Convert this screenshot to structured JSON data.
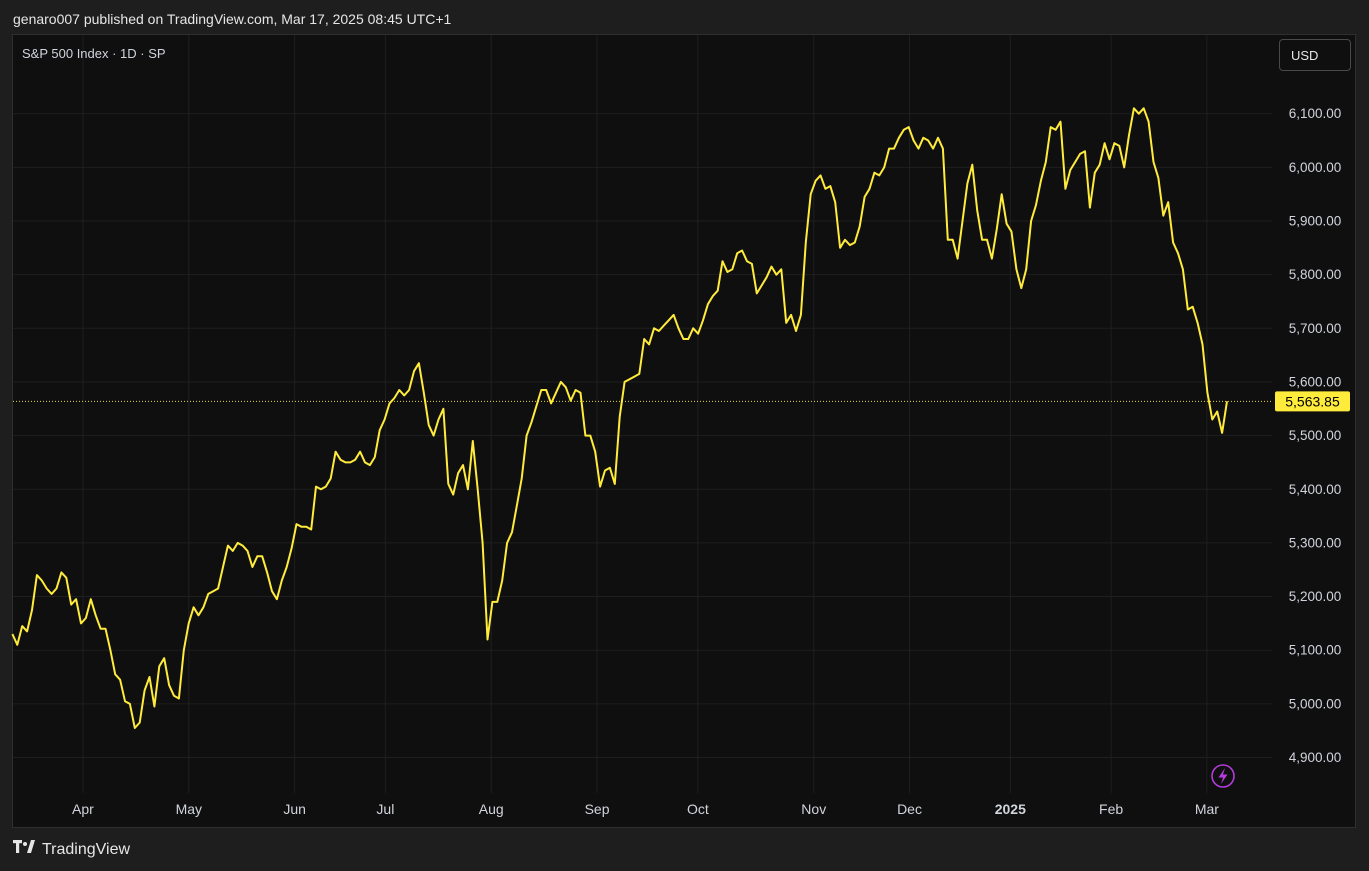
{
  "header": {
    "publish_text": "genaro007 published on TradingView.com, Mar 17, 2025 08:45 UTC+1"
  },
  "legend": {
    "text": "S&P 500 Index · 1D · SP"
  },
  "currency_button": {
    "label": "USD"
  },
  "footer": {
    "brand": "TradingView"
  },
  "colors": {
    "line": "#ffeb3b",
    "background": "#0f0f0f",
    "grid": "#1f1f1f",
    "axis_text": "#d1d4dc",
    "price_label_bg": "#ffeb3b",
    "lightning_icon": "#b43cdc"
  },
  "icons": {
    "lightning": "lightning-icon",
    "logo": "tradingview-logo-icon"
  },
  "chart_data": {
    "type": "line",
    "title": "S&P 500 Index · 1D · SP",
    "ylim": [
      4840,
      6200
    ],
    "y_ticks": [
      4900,
      5000,
      5100,
      5200,
      5300,
      5400,
      5500,
      5600,
      5700,
      5800,
      5900,
      6000,
      6100
    ],
    "y_tick_labels": [
      "4,900.00",
      "5,000.00",
      "5,100.00",
      "5,200.00",
      "5,300.00",
      "5,400.00",
      "5,500.00",
      "5,600.00",
      "5,700.00",
      "5,800.00",
      "5,900.00",
      "6,000.00",
      "6,100.00"
    ],
    "x_ticks": [
      {
        "label": "Apr",
        "t": 14,
        "bold": false
      },
      {
        "label": "May",
        "t": 35,
        "bold": false
      },
      {
        "label": "Jun",
        "t": 56,
        "bold": false
      },
      {
        "label": "Jul",
        "t": 74,
        "bold": false
      },
      {
        "label": "Aug",
        "t": 95,
        "bold": false
      },
      {
        "label": "Sep",
        "t": 116,
        "bold": false
      },
      {
        "label": "Oct",
        "t": 136,
        "bold": false
      },
      {
        "label": "Nov",
        "t": 159,
        "bold": false
      },
      {
        "label": "Dec",
        "t": 178,
        "bold": false
      },
      {
        "label": "2025",
        "t": 198,
        "bold": true
      },
      {
        "label": "Feb",
        "t": 218,
        "bold": false
      },
      {
        "label": "Mar",
        "t": 237,
        "bold": false
      }
    ],
    "t_range": [
      3.2,
      274
    ],
    "last_value": 5563.85,
    "last_value_label": "5,563.85",
    "series": [
      {
        "values": [
          5130,
          5110,
          5145,
          5135,
          5175,
          5240,
          5230,
          5215,
          5205,
          5215,
          5245,
          5235,
          5185,
          5195,
          5150,
          5160,
          5195,
          5165,
          5140,
          5140,
          5100,
          5055,
          5045,
          5005,
          5000,
          4955,
          4965,
          5025,
          5050,
          4995,
          5070,
          5085,
          5035,
          5015,
          5010,
          5100,
          5150,
          5180,
          5165,
          5180,
          5205,
          5210,
          5215,
          5255,
          5295,
          5285,
          5300,
          5295,
          5285,
          5255,
          5275,
          5275,
          5245,
          5210,
          5195,
          5230,
          5255,
          5290,
          5335,
          5330,
          5330,
          5325,
          5405,
          5400,
          5405,
          5420,
          5470,
          5455,
          5450,
          5450,
          5455,
          5470,
          5450,
          5445,
          5460,
          5510,
          5530,
          5560,
          5570,
          5585,
          5575,
          5585,
          5620,
          5635,
          5580,
          5520,
          5500,
          5530,
          5550,
          5410,
          5390,
          5430,
          5445,
          5400,
          5490,
          5400,
          5300,
          5120,
          5190,
          5190,
          5230,
          5300,
          5320,
          5370,
          5420,
          5500,
          5525,
          5555,
          5585,
          5585,
          5560,
          5580,
          5600,
          5590,
          5565,
          5585,
          5580,
          5500,
          5500,
          5470,
          5405,
          5435,
          5440,
          5410,
          5535,
          5600,
          5605,
          5610,
          5615,
          5680,
          5670,
          5700,
          5695,
          5705,
          5715,
          5725,
          5700,
          5680,
          5680,
          5700,
          5690,
          5715,
          5745,
          5760,
          5770,
          5825,
          5805,
          5810,
          5840,
          5845,
          5825,
          5820,
          5765,
          5780,
          5795,
          5815,
          5800,
          5810,
          5710,
          5725,
          5695,
          5725,
          5860,
          5950,
          5975,
          5985,
          5960,
          5965,
          5935,
          5850,
          5865,
          5855,
          5860,
          5890,
          5945,
          5960,
          5990,
          5985,
          6000,
          6035,
          6035,
          6055,
          6070,
          6075,
          6050,
          6035,
          6055,
          6050,
          6035,
          6055,
          6035,
          5865,
          5865,
          5830,
          5900,
          5970,
          6005,
          5920,
          5865,
          5865,
          5830,
          5885,
          5950,
          5895,
          5880,
          5810,
          5775,
          5810,
          5900,
          5930,
          5975,
          6010,
          6075,
          6070,
          6085,
          5960,
          5995,
          6010,
          6025,
          6030,
          5925,
          5990,
          6005,
          6045,
          6015,
          6045,
          6040,
          6000,
          6060,
          6110,
          6100,
          6110,
          6085,
          6010,
          5980,
          5910,
          5935,
          5860,
          5840,
          5810,
          5735,
          5740,
          5710,
          5670,
          5580,
          5530,
          5545,
          5505,
          5563.85
        ]
      }
    ]
  }
}
